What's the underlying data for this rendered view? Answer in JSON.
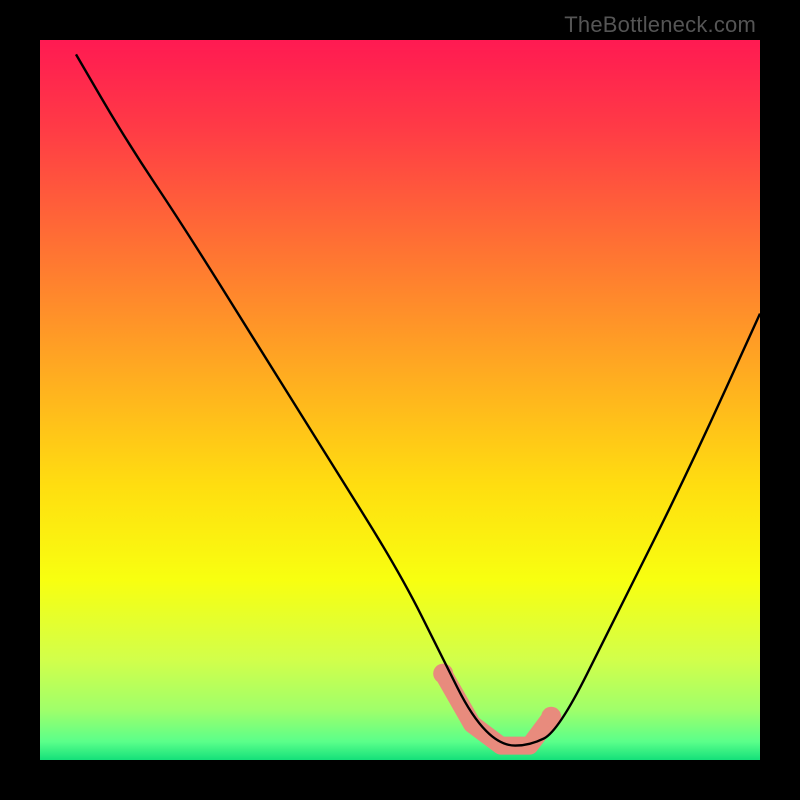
{
  "watermark": "TheBottleneck.com",
  "chart_data": {
    "type": "line",
    "title": "",
    "xlabel": "",
    "ylabel": "",
    "xlim": [
      0,
      100
    ],
    "ylim": [
      0,
      100
    ],
    "grid": false,
    "legend": false,
    "background_gradient_stops": [
      {
        "offset": 0.0,
        "color": "#ff1a52"
      },
      {
        "offset": 0.12,
        "color": "#ff3a46"
      },
      {
        "offset": 0.28,
        "color": "#ff6f34"
      },
      {
        "offset": 0.45,
        "color": "#ffa722"
      },
      {
        "offset": 0.62,
        "color": "#ffde10"
      },
      {
        "offset": 0.75,
        "color": "#f8ff10"
      },
      {
        "offset": 0.86,
        "color": "#d2ff4a"
      },
      {
        "offset": 0.93,
        "color": "#a0ff6a"
      },
      {
        "offset": 0.975,
        "color": "#5aff8a"
      },
      {
        "offset": 1.0,
        "color": "#14e07a"
      }
    ],
    "series": [
      {
        "name": "curve",
        "x": [
          5,
          12,
          20,
          30,
          40,
          50,
          56,
          60,
          64,
          68,
          72,
          80,
          90,
          100
        ],
        "y": [
          98,
          86,
          74,
          58,
          42,
          26,
          14,
          6,
          2,
          2,
          4,
          20,
          40,
          62
        ]
      }
    ],
    "highlight_zone": {
      "name": "salmon-band",
      "color": "#e88b7d",
      "points_x": [
        56,
        60,
        64,
        68,
        71
      ],
      "points_y": [
        12,
        5,
        2,
        2,
        6
      ]
    }
  }
}
